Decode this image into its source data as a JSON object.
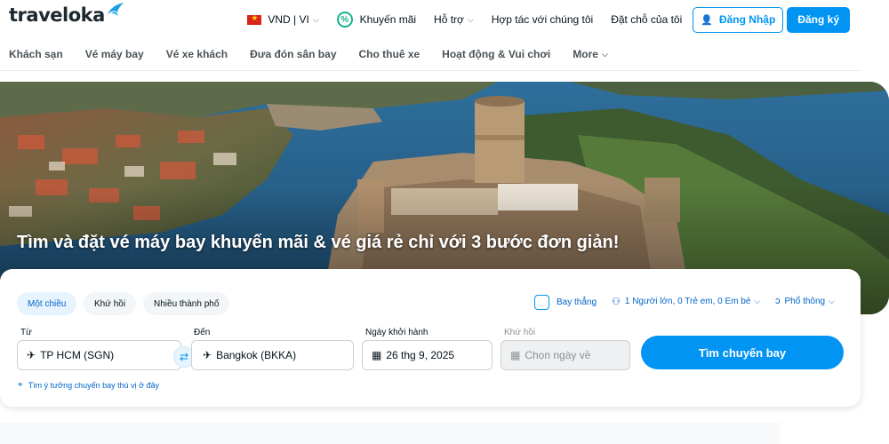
{
  "brand": {
    "logo_text": "traveloka",
    "accent": "#0194f3"
  },
  "header": {
    "currency_lang": "VND | VI",
    "promo": "Khuyến mãi",
    "support": "Hỗ trợ",
    "partner": "Hợp tác với chúng tôi",
    "bookings": "Đặt chỗ của tôi",
    "login": "Đăng Nhập",
    "register": "Đăng ký"
  },
  "categories": [
    "Khách sạn",
    "Vé máy bay",
    "Vé xe khách",
    "Đưa đón sân bay",
    "Cho thuê xe",
    "Hoạt động & Vui chơi",
    "More"
  ],
  "hero": {
    "title": "Tìm và đặt vé máy bay khuyến mãi & vé giá rẻ chỉ với 3 bước đơn giản!"
  },
  "search": {
    "trip_types": [
      "Một chiều",
      "Khứ hồi",
      "Nhiều thành phố"
    ],
    "active_trip_type": "Một chiều",
    "direct_flight": "Bay thẳng",
    "passengers": "1 Người lớn, 0 Trẻ em, 0 Em bé",
    "cabin_class": "Phổ thông",
    "from_label": "Từ",
    "from_value": "TP HCM (SGN)",
    "to_label": "Đến",
    "to_value": "Bangkok (BKKA)",
    "depart_label": "Ngày khởi hành",
    "depart_value": "26 thg 9, 2025",
    "return_label": "Khứ hồi",
    "return_placeholder": "Chọn ngày về",
    "search_button": "Tìm chuyến bay",
    "idea_link": "Tìm ý tưởng chuyến bay thú vị ở đây"
  }
}
